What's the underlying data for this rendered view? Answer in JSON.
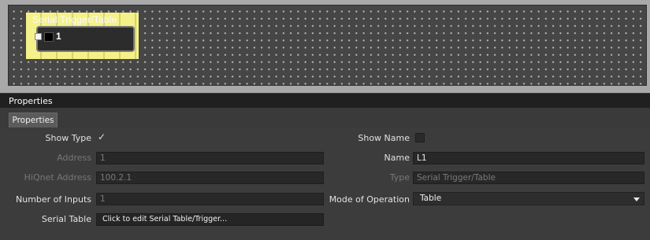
{
  "canvas": {
    "block": {
      "title": "Serial Trigger/Table",
      "port_number": "1"
    }
  },
  "panel": {
    "header": "Properties",
    "tab": "Properties"
  },
  "properties": {
    "show_type": {
      "label": "Show Type",
      "checked": true,
      "check_glyph": "✓"
    },
    "show_name": {
      "label": "Show Name",
      "checked": false
    },
    "address": {
      "label": "Address",
      "value": "1",
      "enabled": false
    },
    "name": {
      "label": "Name",
      "value": "L1",
      "enabled": true
    },
    "hiqnet_address": {
      "label": "HiQnet Address",
      "value": "100.2.1",
      "enabled": false
    },
    "type": {
      "label": "Type",
      "value": "Serial Trigger/Table",
      "enabled": false
    },
    "number_of_inputs": {
      "label": "Number of Inputs",
      "value": "1"
    },
    "mode_of_operation": {
      "label": "Mode of Operation",
      "value": "Table"
    },
    "serial_table": {
      "label": "Serial Table",
      "button_label": "Click to edit Serial Table/Trigger..."
    }
  },
  "colors": {
    "selection_yellow": "#f4f18a",
    "panel_bg": "#3c3c3c",
    "canvas_bg": "#464646"
  }
}
